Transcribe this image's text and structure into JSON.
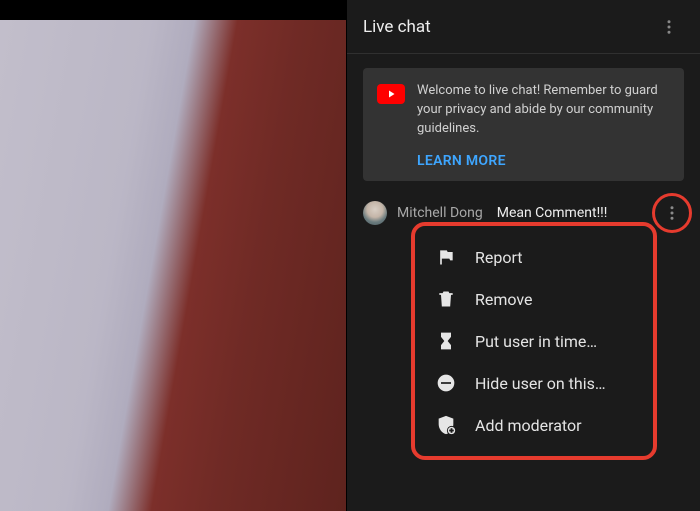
{
  "header": {
    "title": "Live chat"
  },
  "welcome": {
    "text": "Welcome to live chat! Remember to guard your privacy and abide by our community guidelines.",
    "learn_more": "LEARN MORE"
  },
  "message": {
    "author": "Mitchell Dong",
    "text": "Mean Comment!!!"
  },
  "menu": {
    "items": [
      {
        "icon": "flag-icon",
        "label": "Report"
      },
      {
        "icon": "trash-icon",
        "label": "Remove"
      },
      {
        "icon": "hourglass-icon",
        "label": "Put user in time…"
      },
      {
        "icon": "block-icon",
        "label": "Hide user on this…"
      },
      {
        "icon": "shield-add-icon",
        "label": "Add moderator"
      }
    ]
  },
  "colors": {
    "highlight": "#e63b2e",
    "link": "#3ea6ff"
  }
}
